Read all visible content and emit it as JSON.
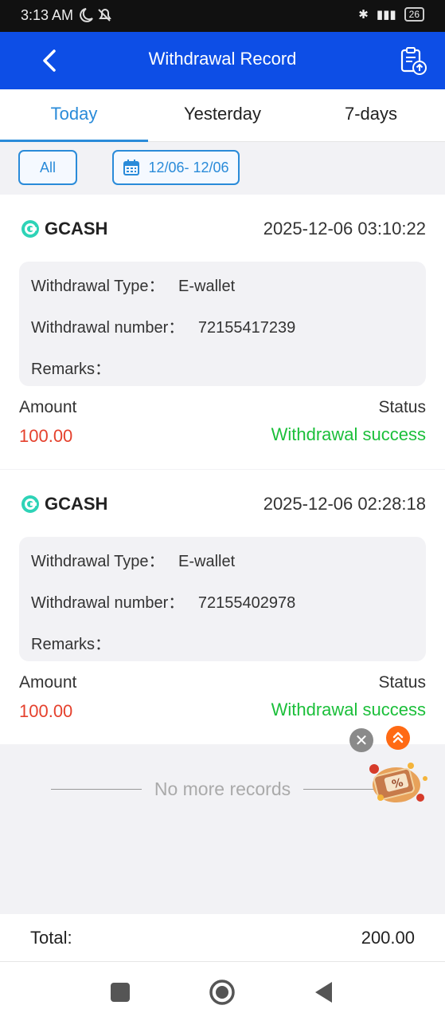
{
  "status_bar": {
    "time": "3:13 AM",
    "battery": "26"
  },
  "header": {
    "title": "Withdrawal Record"
  },
  "tabs": [
    {
      "label": "Today",
      "active": true
    },
    {
      "label": "Yesterday",
      "active": false
    },
    {
      "label": "7-days",
      "active": false
    }
  ],
  "filters": {
    "all_label": "All",
    "date_range": "12/06- 12/06"
  },
  "records": [
    {
      "method": "GCASH",
      "datetime": "2025-12-06 03:10:22",
      "type_label": "Withdrawal Type：",
      "type_value": "E-wallet",
      "number_label": "Withdrawal number：",
      "number_value": "72155417239",
      "remarks_label": "Remarks：",
      "amount_label": "Amount",
      "amount": "100.00",
      "status_label": "Status",
      "status": "Withdrawal success"
    },
    {
      "method": "GCASH",
      "datetime": "2025-12-06 02:28:18",
      "type_label": "Withdrawal Type：",
      "type_value": "E-wallet",
      "number_label": "Withdrawal number：",
      "number_value": "72155402978",
      "remarks_label": "Remarks：",
      "amount_label": "Amount",
      "amount": "100.00",
      "status_label": "Status",
      "status": "Withdrawal success"
    }
  ],
  "list_end": "No more records",
  "total": {
    "label": "Total:",
    "value": "200.00"
  },
  "colors": {
    "header_bg": "#0d4ee6",
    "accent": "#2a8bd9",
    "amount": "#e5412d",
    "success": "#1bbf3a"
  },
  "icons": {
    "back": "chevron-left-icon",
    "upload_record": "clipboard-upload-icon",
    "calendar": "calendar-icon",
    "gcash": "gcash-logo-icon",
    "close": "close-icon",
    "scroll_top": "double-chevron-up-icon",
    "promo": "promo-gift-icon",
    "nav_recents": "square-icon",
    "nav_home": "circle-icon",
    "nav_back": "triangle-back-icon"
  }
}
